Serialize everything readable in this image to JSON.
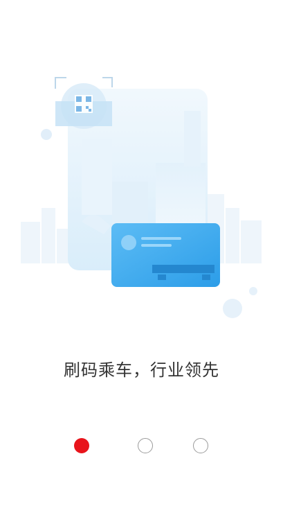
{
  "slide": {
    "caption": "刷码乘车，行业领先",
    "illustration_icon": "qr-boarding-card-illustration"
  },
  "pager": {
    "total": 3,
    "active_index": 0,
    "active_color": "#e8141b",
    "inactive_color": "#9a9a9a"
  },
  "colors": {
    "background": "#ffffff",
    "card_blue": "#3ea9ef",
    "panel_light_blue": "#dff0fb",
    "caption_text": "#333333"
  }
}
